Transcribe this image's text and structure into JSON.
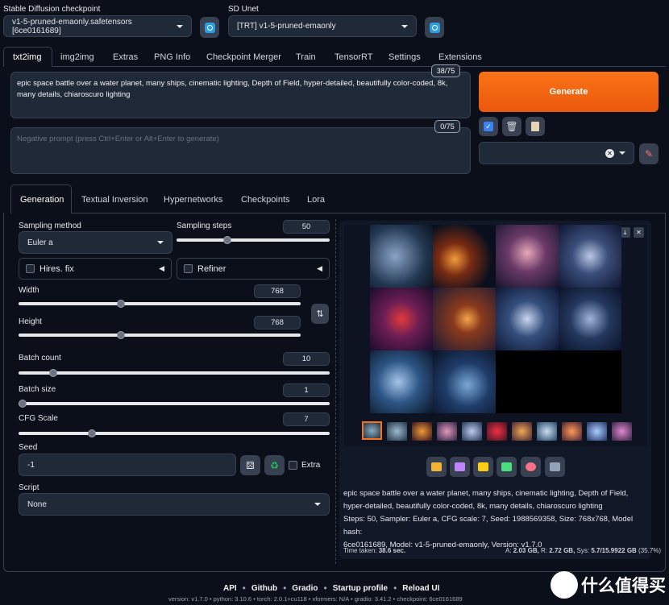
{
  "top": {
    "checkpoint_label": "Stable Diffusion checkpoint",
    "checkpoint_value": "v1-5-pruned-emaonly.safetensors [6ce0161689]",
    "unet_label": "SD Unet",
    "unet_value": "[TRT] v1-5-pruned-emaonly"
  },
  "tabs": [
    "txt2img",
    "img2img",
    "Extras",
    "PNG Info",
    "Checkpoint Merger",
    "Train",
    "TensorRT",
    "Settings",
    "Extensions"
  ],
  "prompt": {
    "text": "epic space battle over a water planet, many ships, cinematic lighting, Depth of Field, hyper-detailed, beautifully color-coded, 8k, many details, chiaroscuro lighting",
    "counter": "38/75"
  },
  "negative": {
    "placeholder": "Negative prompt (press Ctrl+Enter or Alt+Enter to generate)",
    "counter": "0/75"
  },
  "generate_label": "Generate",
  "subtabs": [
    "Generation",
    "Textual Inversion",
    "Hypernetworks",
    "Checkpoints",
    "Lora"
  ],
  "params": {
    "sampling_method_label": "Sampling method",
    "sampling_method": "Euler a",
    "sampling_steps_label": "Sampling steps",
    "sampling_steps": "50",
    "hires_label": "Hires. fix",
    "refiner_label": "Refiner",
    "width_label": "Width",
    "width": "768",
    "height_label": "Height",
    "height": "768",
    "batch_count_label": "Batch count",
    "batch_count": "10",
    "batch_size_label": "Batch size",
    "batch_size": "1",
    "cfg_label": "CFG Scale",
    "cfg": "7",
    "seed_label": "Seed",
    "seed": "-1",
    "extra_label": "Extra",
    "script_label": "Script",
    "script": "None"
  },
  "sliders": {
    "sampling_steps": 0.32,
    "width": 0.36,
    "height": 0.36,
    "batch_count": 0.1,
    "batch_size": 0.0,
    "cfg": 0.23
  },
  "output": {
    "info_line1": "epic space battle over a water planet, many ships, cinematic lighting, Depth of Field,",
    "info_line2": "hyper-detailed, beautifully color-coded, 8k, many details, chiaroscuro lighting",
    "info_line3": "Steps: 50, Sampler: Euler a, CFG scale: 7, Seed: 1988569358, Size: 768x768, Model hash:",
    "info_line4": "6ce0161689, Model: v1-5-pruned-emaonly, Version: v1.7.0",
    "time_label": "Time taken:",
    "time_value": "38.6 sec.",
    "mem_a_label": "A:",
    "mem_a": "2.03 GB,",
    "mem_r_label": "R:",
    "mem_r": "2.72 GB,",
    "mem_sys_label": "Sys:",
    "mem_sys": "5.7/15.9922 GB",
    "mem_pct": "(35.7%)"
  },
  "footer": {
    "links": [
      "API",
      "Github",
      "Gradio",
      "Startup profile",
      "Reload UI"
    ],
    "version_line": "version: v1.7.0  •  python: 3.10.6  •  torch: 2.0.1+cu118  •  xformers: N/A  •  gradio: 3.41.2  •  checkpoint: 6ce0161689"
  },
  "watermark": "值 什么值得买",
  "colors": {
    "accent": "#f97316",
    "bg": "#0b0f19",
    "panel": "#111827",
    "input": "#1f2937"
  }
}
